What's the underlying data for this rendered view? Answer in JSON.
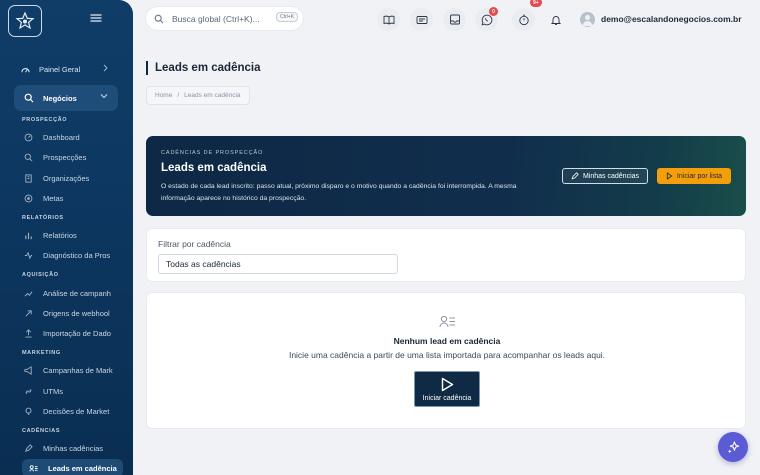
{
  "sidebar": {
    "logo_icon": "star-badge-icon",
    "menu_icon": "hamburger-icon",
    "top_item": {
      "label": "Painel Geral",
      "icon": "dashboard-gauge-icon"
    },
    "active_group": {
      "label": "Negócios",
      "icon": "search-icon"
    },
    "sections": [
      {
        "title": "PROSPECÇÃO",
        "items": [
          "Dashboard",
          "Prospecções",
          "Organizações",
          "Metas"
        ]
      },
      {
        "title": "RELATÓRIOS",
        "items": [
          "Relatórios",
          "Diagnóstico da Pros"
        ]
      },
      {
        "title": "AQUISIÇÃO",
        "items": [
          "Análise de campanh",
          "Origens de webhool",
          "Importação de Dado"
        ]
      },
      {
        "title": "MARKETING",
        "items": [
          "Campanhas de Mark",
          "UTMs",
          "Decisões de Market"
        ]
      },
      {
        "title": "CADÊNCIAS",
        "items": [
          "Minhas cadências",
          "Leads em cadência"
        ]
      }
    ]
  },
  "topbar": {
    "search_placeholder": "Busca global (Ctrl+K)...",
    "search_shortcut": "Ctrl+K",
    "icons": [
      "book-icon",
      "card-icon",
      "inbox-icon",
      "whatsapp-icon",
      "timer-icon",
      "bell-icon"
    ],
    "whatsapp_badge": "0",
    "timer_badge": "9+",
    "user_email": "demo@escalandonegocios.com.br"
  },
  "page": {
    "title": "Leads em cadência",
    "breadcrumb": [
      "Home",
      "Leads em cadência"
    ]
  },
  "hero": {
    "kicker": "CADÊNCIAS DE PROSPECÇÃO",
    "title": "Leads em cadência",
    "description": "O estado de cada lead inscrito: passo atual, próximo disparo e o motivo quando a cadência foi interrompida. A mesma informação aparece no histórico da prospecção.",
    "btn_secondary": "Minhas cadências",
    "btn_primary": "Iniciar por lista"
  },
  "filter": {
    "label": "Filtrar por cadência",
    "value": "Todas as cadências"
  },
  "empty_state": {
    "title": "Nenhum lead em cadência",
    "subtitle": "Inicie uma cadência a partir de uma lista importada para acompanhar os leads aqui.",
    "button": "Iniciar cadência"
  },
  "colors": {
    "sidebar": "#0f3d68",
    "accent": "#f59e0b",
    "fab": "#5b5bd6",
    "badge": "#e5484d"
  }
}
